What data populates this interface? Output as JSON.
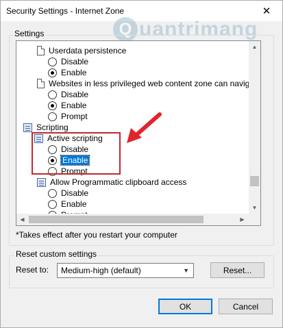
{
  "window": {
    "title": "Security Settings - Internet Zone",
    "close_glyph": "✕"
  },
  "watermark": {
    "logo_letter": "Q",
    "text": "uantrimang"
  },
  "settings": {
    "label": "Settings",
    "rows": [
      {
        "kind": "page",
        "label": "Userdata persistence"
      },
      {
        "kind": "radio",
        "label": "Disable",
        "checked": false
      },
      {
        "kind": "radio",
        "label": "Enable",
        "checked": true
      },
      {
        "kind": "page",
        "label": "Websites in less privileged web content zone can navigate in"
      },
      {
        "kind": "radio",
        "label": "Disable",
        "checked": false
      },
      {
        "kind": "radio",
        "label": "Enable",
        "checked": true
      },
      {
        "kind": "radio",
        "label": "Prompt",
        "checked": false
      },
      {
        "kind": "script",
        "label": "Scripting"
      },
      {
        "kind": "script",
        "label": "Active scripting"
      },
      {
        "kind": "radio",
        "label": "Disable",
        "checked": false
      },
      {
        "kind": "radio",
        "label": "Enable",
        "checked": true,
        "selected": true
      },
      {
        "kind": "radio",
        "label": "Prompt",
        "checked": false
      },
      {
        "kind": "script",
        "label": "Allow Programmatic clipboard access"
      },
      {
        "kind": "radio",
        "label": "Disable",
        "checked": false
      },
      {
        "kind": "radio",
        "label": "Enable",
        "checked": false
      },
      {
        "kind": "radio",
        "label": "Prompt",
        "checked": true
      }
    ],
    "note": "*Takes effect after you restart your computer"
  },
  "reset": {
    "group_label": "Reset custom settings",
    "reset_to_label": "Reset to:",
    "selected": "Medium-high (default)",
    "reset_button": "Reset..."
  },
  "footer": {
    "ok": "OK",
    "cancel": "Cancel"
  },
  "colors": {
    "selection": "#0078d7",
    "highlight_box": "#c0282f",
    "arrow": "#e0252b"
  },
  "icons": {
    "page": "page-icon",
    "script": "script-icon",
    "scroll_up": "▲",
    "scroll_down": "▼",
    "scroll_left": "◀",
    "scroll_right": "▶",
    "dropdown": "▼"
  }
}
